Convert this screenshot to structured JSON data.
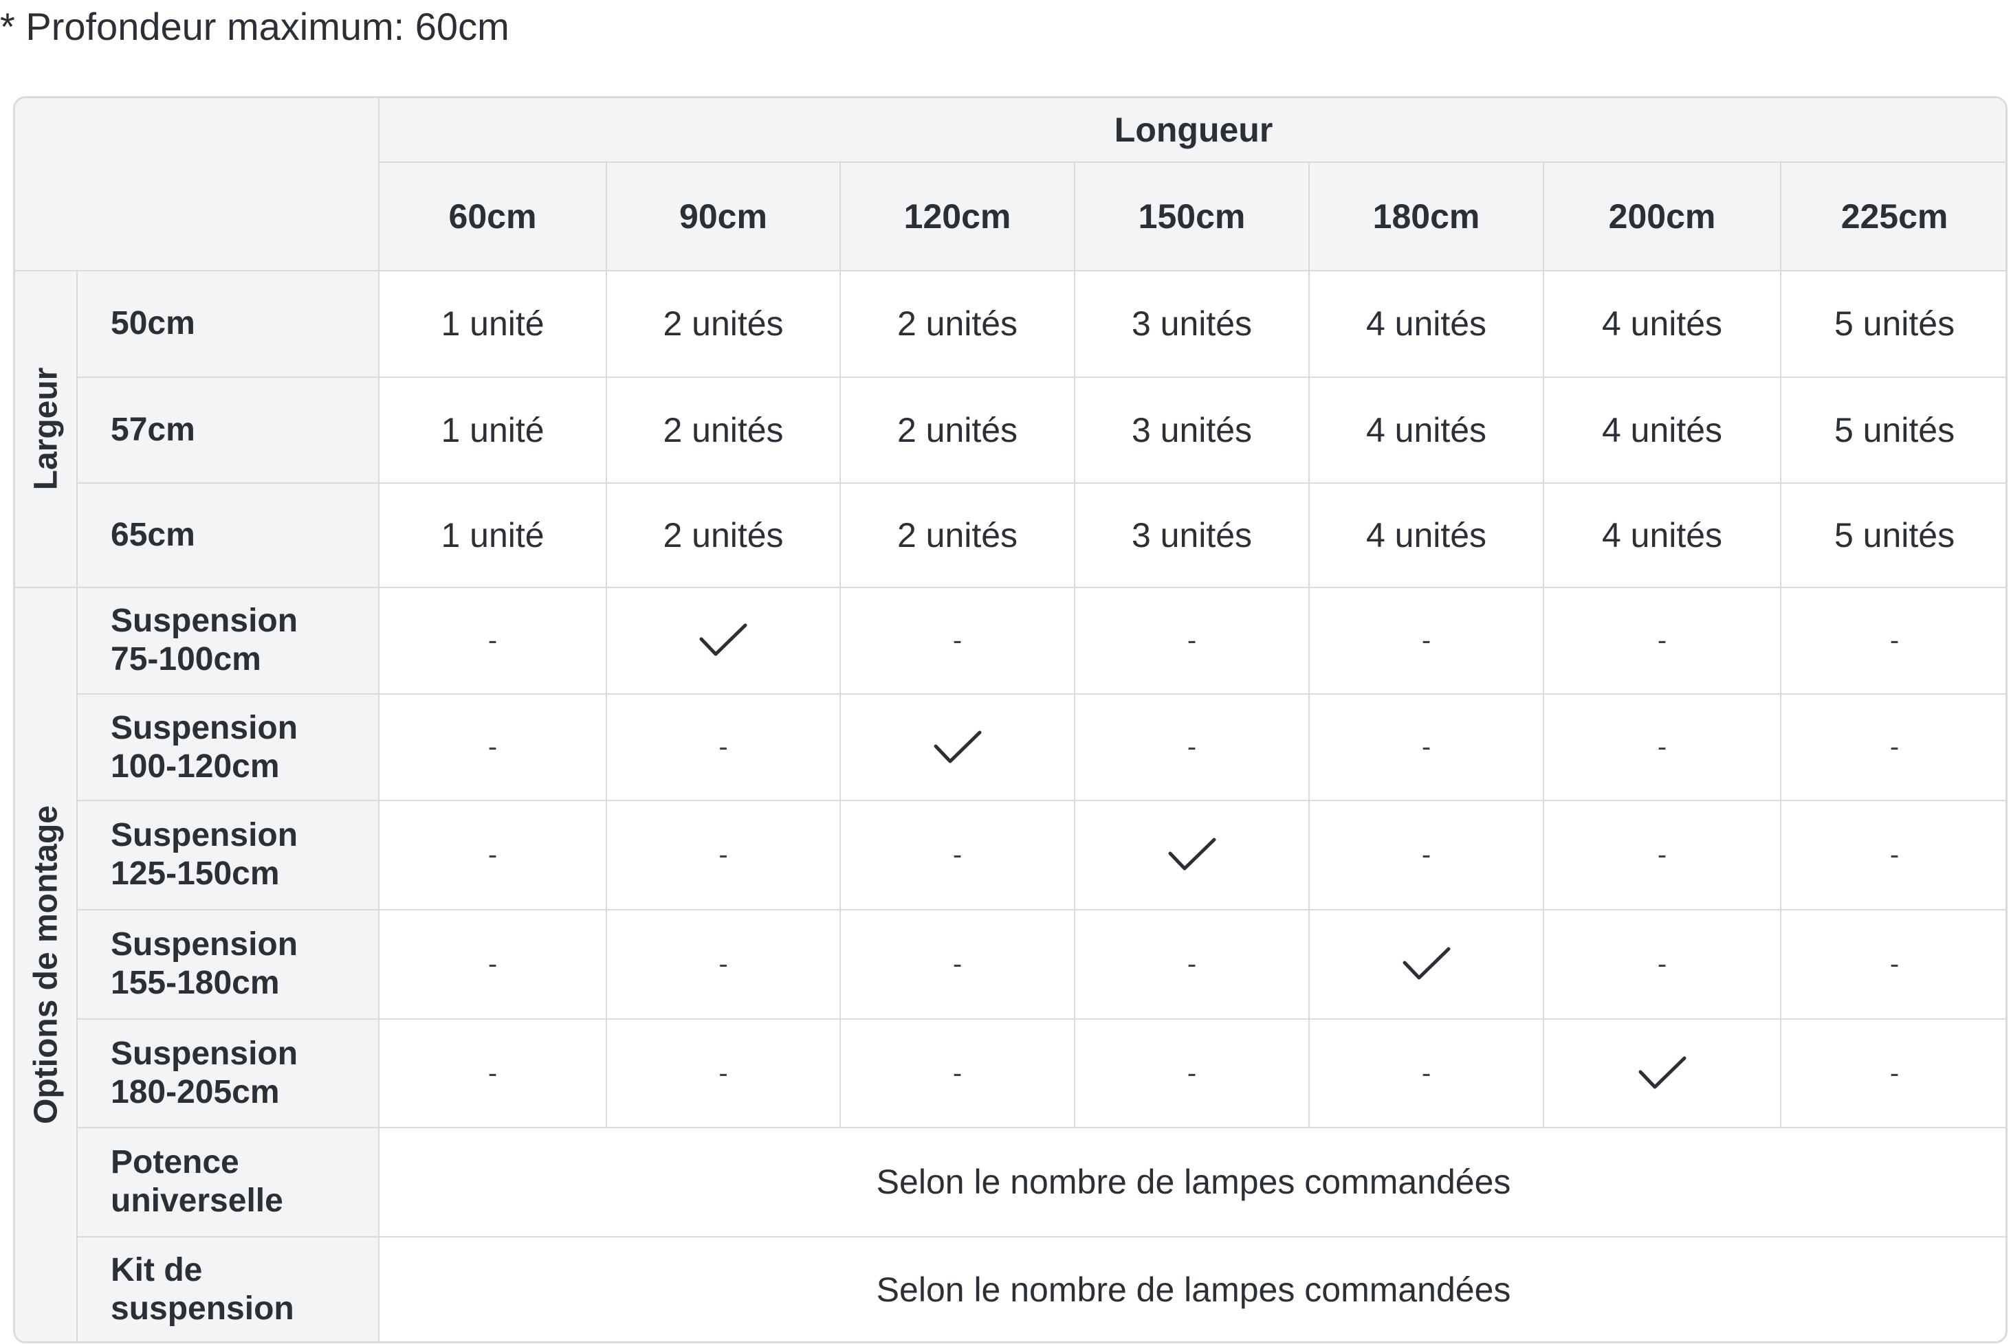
{
  "note": "* Profondeur maximum: 60cm",
  "header": {
    "group_label": "Longueur",
    "columns": [
      "60cm",
      "90cm",
      "120cm",
      "150cm",
      "180cm",
      "200cm",
      "225cm"
    ]
  },
  "largeur": {
    "group_label": "Largeur",
    "rows": [
      {
        "label": "50cm",
        "cells": [
          "1 unité",
          "2 unités",
          "2 unités",
          "3 unités",
          "4 unités",
          "4 unités",
          "5 unités"
        ]
      },
      {
        "label": "57cm",
        "cells": [
          "1 unité",
          "2 unités",
          "2 unités",
          "3 unités",
          "4 unités",
          "4 unités",
          "5 unités"
        ]
      },
      {
        "label": "65cm",
        "cells": [
          "1 unité",
          "2 unités",
          "2 unités",
          "3 unités",
          "4 unités",
          "4 unités",
          "5 unités"
        ]
      }
    ]
  },
  "montage": {
    "group_label": "Options de montage",
    "rows": [
      {
        "label_line1": "Suspension",
        "label_line2": "75-100cm",
        "cells": [
          "-",
          "check",
          "-",
          "-",
          "-",
          "-",
          "-"
        ]
      },
      {
        "label_line1": "Suspension",
        "label_line2": "100-120cm",
        "cells": [
          "-",
          "-",
          "check",
          "-",
          "-",
          "-",
          "-"
        ]
      },
      {
        "label_line1": "Suspension",
        "label_line2": "125-150cm",
        "cells": [
          "-",
          "-",
          "-",
          "check",
          "-",
          "-",
          "-"
        ]
      },
      {
        "label_line1": "Suspension",
        "label_line2": "155-180cm",
        "cells": [
          "-",
          "-",
          "-",
          "-",
          "check",
          "-",
          "-"
        ]
      },
      {
        "label_line1": "Suspension",
        "label_line2": "180-205cm",
        "cells": [
          "-",
          "-",
          "-",
          "-",
          "-",
          "check",
          "-"
        ]
      }
    ],
    "span_rows": [
      {
        "label_line1": "Potence",
        "label_line2": "universelle",
        "text": "Selon le nombre de lampes commandées"
      },
      {
        "label_line1": "Kit de",
        "label_line2": "suspension",
        "text": "Selon le nombre de lampes commandées"
      }
    ]
  },
  "icons": {
    "check": "checkmark-icon"
  }
}
